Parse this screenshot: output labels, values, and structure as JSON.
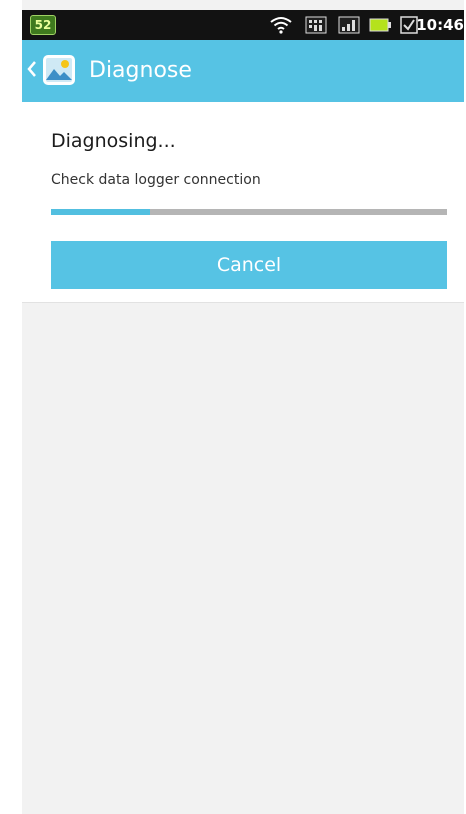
{
  "status_bar": {
    "notification_badge": "52",
    "time": "10:46",
    "icons": [
      "wifi-icon",
      "signal-strength-icon",
      "mobile-signal-icon",
      "battery-icon",
      "checkbox-notification-icon"
    ]
  },
  "action_bar": {
    "title": "Diagnose",
    "icons": [
      "back-chevron-icon",
      "landscape-image-icon"
    ],
    "color": "#56c3e4"
  },
  "diagnose": {
    "heading": "Diagnosing...",
    "status_text": "Check data logger connection",
    "progress_fraction": 0.25,
    "cancel_label": "Cancel"
  },
  "colors": {
    "accent": "#56c3e4",
    "progress_track": "#b5b5b5",
    "background": "#f2f2f2"
  }
}
